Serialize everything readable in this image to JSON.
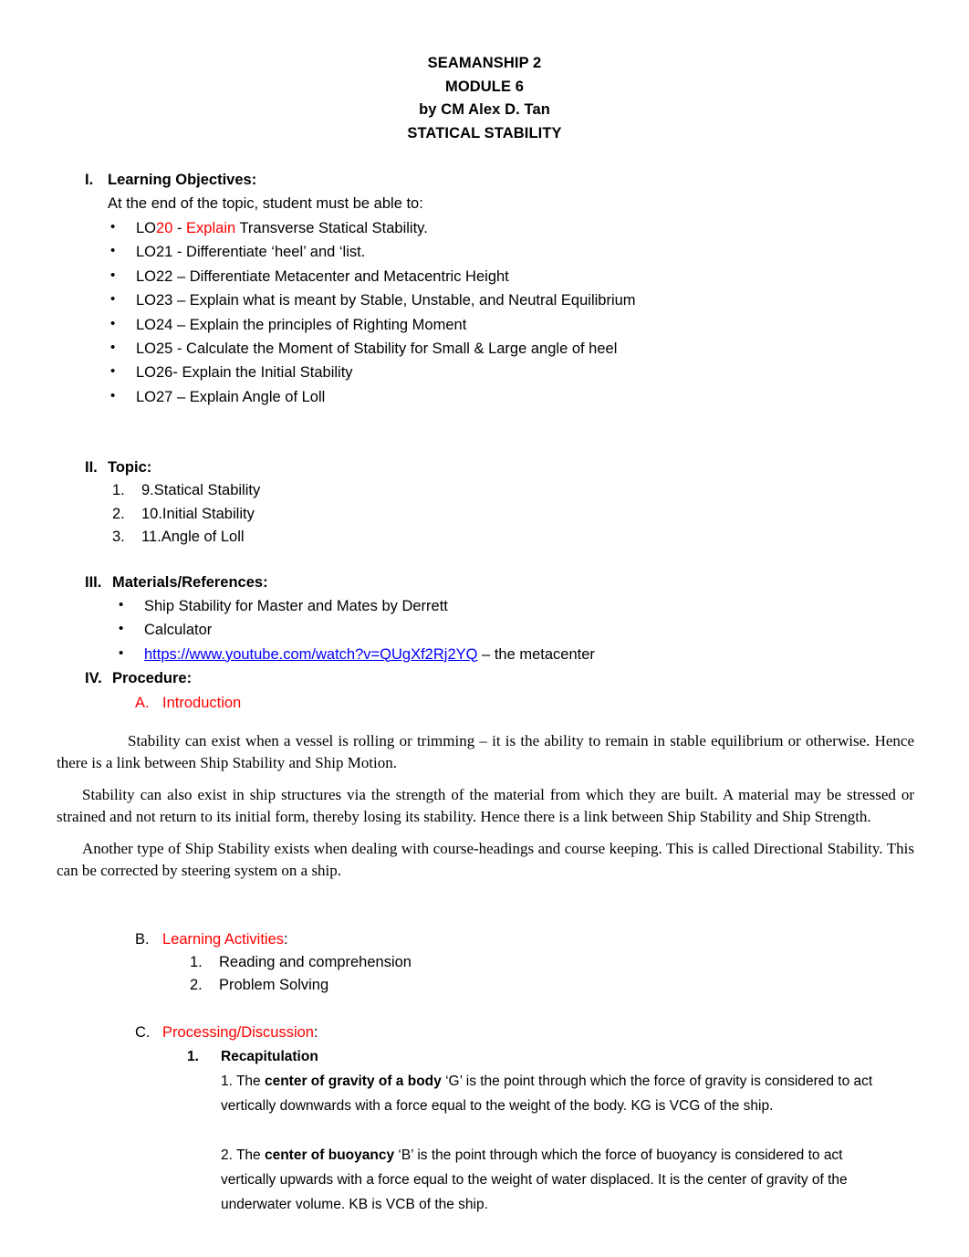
{
  "document": {
    "title_lines": [
      "SEAMANSHIP 2",
      "MODULE 6",
      "by CM Alex D. Tan",
      "STATICAL STABILITY"
    ],
    "colors": {
      "red": "#FF0000",
      "link_blue": "#0000FF",
      "text": "#000000"
    }
  },
  "section_1": {
    "numeral": "I.",
    "heading": "Learning Objectives:",
    "lead_in": "At the end of the topic, student must be able to:",
    "objectives": [
      {
        "parts": [
          {
            "text": "LO",
            "color": "black"
          },
          {
            "text": "20",
            "color": "red"
          },
          {
            "text": " - ",
            "color": "black"
          },
          {
            "text": "Explain",
            "color": "red"
          },
          {
            "text": " Transverse Statical Stability.",
            "color": "black"
          }
        ],
        "plain": "LO20 - Explain Transverse Statical Stability."
      },
      {
        "plain": "LO21 - Differentiate ‘heel’ and ‘list."
      },
      {
        "plain": "LO22 – Differentiate Metacenter and Metacentric Height"
      },
      {
        "plain": "LO23 – Explain what is meant by Stable, Unstable, and Neutral Equilibrium"
      },
      {
        "plain": "LO24 – Explain the principles of Righting Moment"
      },
      {
        "plain": "LO25 - Calculate the Moment of Stability for Small & Large angle of heel"
      },
      {
        "plain": "LO26-  Explain the Initial Stability"
      },
      {
        "plain": "LO27 – Explain Angle of Loll"
      }
    ]
  },
  "section_2": {
    "numeral": "II.",
    "heading": "Topic:",
    "items": [
      {
        "n": "1.",
        "text": "9.Statical Stability"
      },
      {
        "n": "2.",
        "text": "10.Initial Stability"
      },
      {
        "n": "3.",
        "text": "11.Angle of Loll"
      }
    ]
  },
  "section_3": {
    "numeral": "III.",
    "heading": "Materials/References:",
    "items": [
      {
        "type": "text",
        "text": "Ship Stability for Master and Mates by Derrett"
      },
      {
        "type": "text",
        "text": "Calculator"
      },
      {
        "type": "link",
        "url": "https://www.youtube.com/watch?v=QUgXf2Rj2YQ",
        "suffix": " – the metacenter"
      }
    ]
  },
  "section_4": {
    "numeral": "IV.",
    "heading": "Procedure:",
    "subsection_a": {
      "letter": "A.",
      "label": "Introduction",
      "paragraphs": [
        "Stability can exist when a vessel is rolling or trimming – it is the ability to remain in stable equilibrium or otherwise. Hence there is a link between Ship Stability and Ship Motion.",
        "Stability can also exist in ship structures via the strength of the material from which they are built. A material may be stressed or strained and not return to its initial form, thereby losing its stability. Hence there is a link between Ship Stability and Ship Strength.",
        "Another type of Ship Stability exists when dealing with course-headings and course keeping. This is called Directional Stability. This can be corrected by steering system on a ship."
      ]
    },
    "subsection_b": {
      "letter": "B.",
      "label": "Learning Activities",
      "colon": ":",
      "items": [
        {
          "n": "1.",
          "text": "Reading and comprehension"
        },
        {
          "n": "2.",
          "text": "Problem Solving"
        }
      ]
    },
    "subsection_c": {
      "letter": "C.",
      "label": "Processing/Discussion",
      "colon": ":",
      "item_number": "1.",
      "item_title": "Recapitulation",
      "recap_items": [
        {
          "lead": "1. The ",
          "bold": "center of gravity of a body",
          "rest": " ‘G’ is the point through which the force of gravity is considered to act vertically downwards with a force equal to the weight of the body. KG is VCG of the ship."
        },
        {
          "lead": "2. The ",
          "bold": "center of buoyancy",
          "rest": " ‘B’ is the point through which the force of buoyancy is considered to act vertically upwards with a force equal to the weight of water displaced. It is the center of gravity of the underwater volume. KB is VCB of the ship."
        }
      ]
    }
  }
}
